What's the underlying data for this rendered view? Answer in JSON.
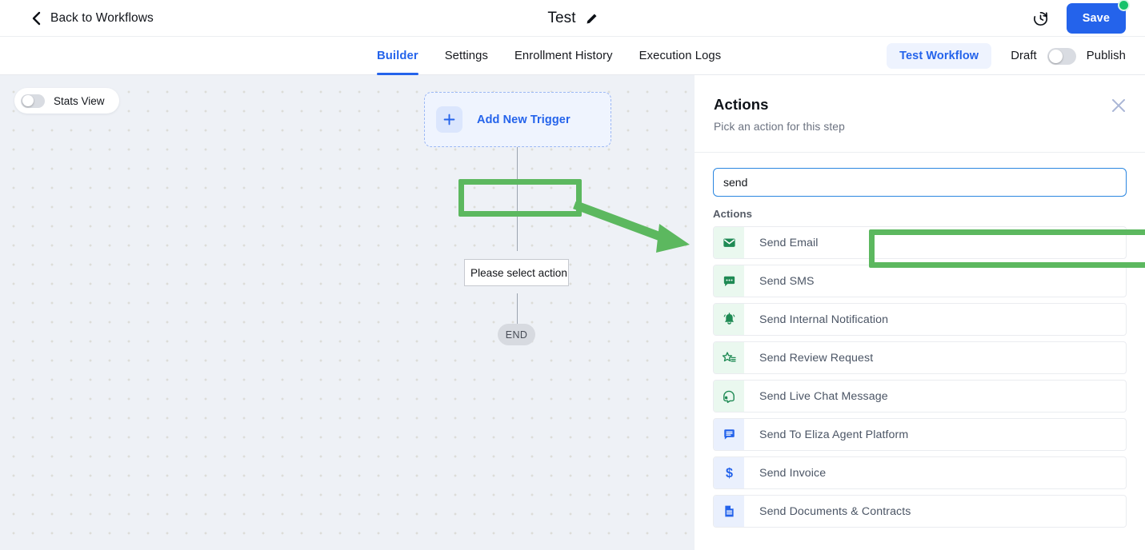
{
  "topbar": {
    "back_label": "Back to Workflows",
    "back_icon": "chevron-left-icon",
    "title": "Test",
    "edit_icon": "pencil-icon",
    "history_icon": "history-clock-icon",
    "save_label": "Save",
    "save_badge_color": "#16c26a",
    "accent_color": "#2463eb"
  },
  "tabs": [
    {
      "label": "Builder",
      "active": true
    },
    {
      "label": "Settings",
      "active": false
    },
    {
      "label": "Enrollment History",
      "active": false
    },
    {
      "label": "Execution Logs",
      "active": false
    }
  ],
  "tabbar_right": {
    "test_workflow_label": "Test Workflow",
    "draft_label": "Draft",
    "publish_label": "Publish",
    "publish_toggle_state": "off"
  },
  "canvas": {
    "stats_view_label": "Stats View",
    "stats_view_toggle_state": "off",
    "add_trigger_label": "Add New Trigger",
    "add_trigger_icon": "plus-icon",
    "select_action_label": "Please select action",
    "end_label": "END"
  },
  "panel": {
    "title": "Actions",
    "subtitle": "Pick an action for this step",
    "close_icon": "close-icon",
    "search_value": "send",
    "search_placeholder": "",
    "list_header": "Actions",
    "items": [
      {
        "label": "Send Email",
        "icon": "envelope-icon",
        "icon_color": "#1f8a54",
        "icon_bg": "#eaf8ef",
        "highlighted": true
      },
      {
        "label": "Send SMS",
        "icon": "chat-bubble-dots-icon",
        "icon_color": "#1f8a54",
        "icon_bg": "#eaf8ef",
        "highlighted": false
      },
      {
        "label": "Send Internal Notification",
        "icon": "bell-icon",
        "icon_color": "#1f8a54",
        "icon_bg": "#eaf8ef",
        "highlighted": false
      },
      {
        "label": "Send Review Request",
        "icon": "star-list-icon",
        "icon_color": "#1f8a54",
        "icon_bg": "#eaf8ef",
        "highlighted": false
      },
      {
        "label": "Send Live Chat Message",
        "icon": "headset-chat-icon",
        "icon_color": "#1f8a54",
        "icon_bg": "#eaf8ef",
        "highlighted": false
      },
      {
        "label": "Send To Eliza Agent Platform",
        "icon": "message-lines-icon",
        "icon_color": "#2463eb",
        "icon_bg": "#eaf0fd",
        "highlighted": false
      },
      {
        "label": "Send Invoice",
        "icon": "dollar-sign-icon",
        "icon_color": "#2463eb",
        "icon_bg": "#eaf0fd",
        "highlighted": false
      },
      {
        "label": "Send Documents & Contracts",
        "icon": "document-icon",
        "icon_color": "#2463eb",
        "icon_bg": "#eaf0fd",
        "highlighted": false
      }
    ]
  },
  "annotations": {
    "color": "#5cb85f",
    "arrow_icon": "arrow-pointing-right-icon",
    "highlight_targets": [
      "Please select action",
      "Send Email"
    ]
  }
}
